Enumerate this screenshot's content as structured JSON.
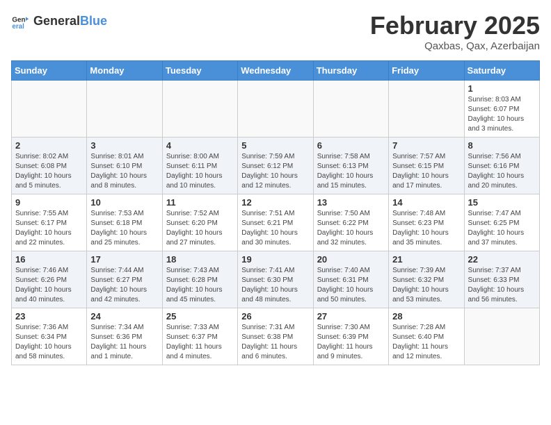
{
  "header": {
    "logo": {
      "general": "General",
      "blue": "Blue"
    },
    "title": "February 2025",
    "subtitle": "Qaxbas, Qax, Azerbaijan"
  },
  "columns": [
    "Sunday",
    "Monday",
    "Tuesday",
    "Wednesday",
    "Thursday",
    "Friday",
    "Saturday"
  ],
  "weeks": [
    [
      {
        "day": "",
        "info": ""
      },
      {
        "day": "",
        "info": ""
      },
      {
        "day": "",
        "info": ""
      },
      {
        "day": "",
        "info": ""
      },
      {
        "day": "",
        "info": ""
      },
      {
        "day": "",
        "info": ""
      },
      {
        "day": "1",
        "info": "Sunrise: 8:03 AM\nSunset: 6:07 PM\nDaylight: 10 hours and 3 minutes."
      }
    ],
    [
      {
        "day": "2",
        "info": "Sunrise: 8:02 AM\nSunset: 6:08 PM\nDaylight: 10 hours and 5 minutes."
      },
      {
        "day": "3",
        "info": "Sunrise: 8:01 AM\nSunset: 6:10 PM\nDaylight: 10 hours and 8 minutes."
      },
      {
        "day": "4",
        "info": "Sunrise: 8:00 AM\nSunset: 6:11 PM\nDaylight: 10 hours and 10 minutes."
      },
      {
        "day": "5",
        "info": "Sunrise: 7:59 AM\nSunset: 6:12 PM\nDaylight: 10 hours and 12 minutes."
      },
      {
        "day": "6",
        "info": "Sunrise: 7:58 AM\nSunset: 6:13 PM\nDaylight: 10 hours and 15 minutes."
      },
      {
        "day": "7",
        "info": "Sunrise: 7:57 AM\nSunset: 6:15 PM\nDaylight: 10 hours and 17 minutes."
      },
      {
        "day": "8",
        "info": "Sunrise: 7:56 AM\nSunset: 6:16 PM\nDaylight: 10 hours and 20 minutes."
      }
    ],
    [
      {
        "day": "9",
        "info": "Sunrise: 7:55 AM\nSunset: 6:17 PM\nDaylight: 10 hours and 22 minutes."
      },
      {
        "day": "10",
        "info": "Sunrise: 7:53 AM\nSunset: 6:18 PM\nDaylight: 10 hours and 25 minutes."
      },
      {
        "day": "11",
        "info": "Sunrise: 7:52 AM\nSunset: 6:20 PM\nDaylight: 10 hours and 27 minutes."
      },
      {
        "day": "12",
        "info": "Sunrise: 7:51 AM\nSunset: 6:21 PM\nDaylight: 10 hours and 30 minutes."
      },
      {
        "day": "13",
        "info": "Sunrise: 7:50 AM\nSunset: 6:22 PM\nDaylight: 10 hours and 32 minutes."
      },
      {
        "day": "14",
        "info": "Sunrise: 7:48 AM\nSunset: 6:23 PM\nDaylight: 10 hours and 35 minutes."
      },
      {
        "day": "15",
        "info": "Sunrise: 7:47 AM\nSunset: 6:25 PM\nDaylight: 10 hours and 37 minutes."
      }
    ],
    [
      {
        "day": "16",
        "info": "Sunrise: 7:46 AM\nSunset: 6:26 PM\nDaylight: 10 hours and 40 minutes."
      },
      {
        "day": "17",
        "info": "Sunrise: 7:44 AM\nSunset: 6:27 PM\nDaylight: 10 hours and 42 minutes."
      },
      {
        "day": "18",
        "info": "Sunrise: 7:43 AM\nSunset: 6:28 PM\nDaylight: 10 hours and 45 minutes."
      },
      {
        "day": "19",
        "info": "Sunrise: 7:41 AM\nSunset: 6:30 PM\nDaylight: 10 hours and 48 minutes."
      },
      {
        "day": "20",
        "info": "Sunrise: 7:40 AM\nSunset: 6:31 PM\nDaylight: 10 hours and 50 minutes."
      },
      {
        "day": "21",
        "info": "Sunrise: 7:39 AM\nSunset: 6:32 PM\nDaylight: 10 hours and 53 minutes."
      },
      {
        "day": "22",
        "info": "Sunrise: 7:37 AM\nSunset: 6:33 PM\nDaylight: 10 hours and 56 minutes."
      }
    ],
    [
      {
        "day": "23",
        "info": "Sunrise: 7:36 AM\nSunset: 6:34 PM\nDaylight: 10 hours and 58 minutes."
      },
      {
        "day": "24",
        "info": "Sunrise: 7:34 AM\nSunset: 6:36 PM\nDaylight: 11 hours and 1 minute."
      },
      {
        "day": "25",
        "info": "Sunrise: 7:33 AM\nSunset: 6:37 PM\nDaylight: 11 hours and 4 minutes."
      },
      {
        "day": "26",
        "info": "Sunrise: 7:31 AM\nSunset: 6:38 PM\nDaylight: 11 hours and 6 minutes."
      },
      {
        "day": "27",
        "info": "Sunrise: 7:30 AM\nSunset: 6:39 PM\nDaylight: 11 hours and 9 minutes."
      },
      {
        "day": "28",
        "info": "Sunrise: 7:28 AM\nSunset: 6:40 PM\nDaylight: 11 hours and 12 minutes."
      },
      {
        "day": "",
        "info": ""
      }
    ]
  ]
}
